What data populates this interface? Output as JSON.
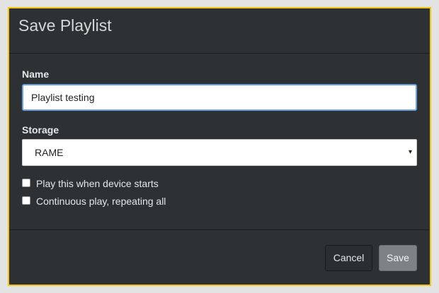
{
  "dialog": {
    "title": "Save Playlist",
    "accent_color": "#f1c40f",
    "background_color": "#2e3134"
  },
  "form": {
    "name_label": "Name",
    "name_value": "Playlist testing",
    "storage_label": "Storage",
    "storage_selected": "RAME",
    "storage_arrow": "▾",
    "checkboxes": [
      {
        "label": "Play this when device starts",
        "checked": false
      },
      {
        "label": "Continuous play, repeating all",
        "checked": false
      }
    ]
  },
  "footer": {
    "cancel_label": "Cancel",
    "save_label": "Save"
  }
}
